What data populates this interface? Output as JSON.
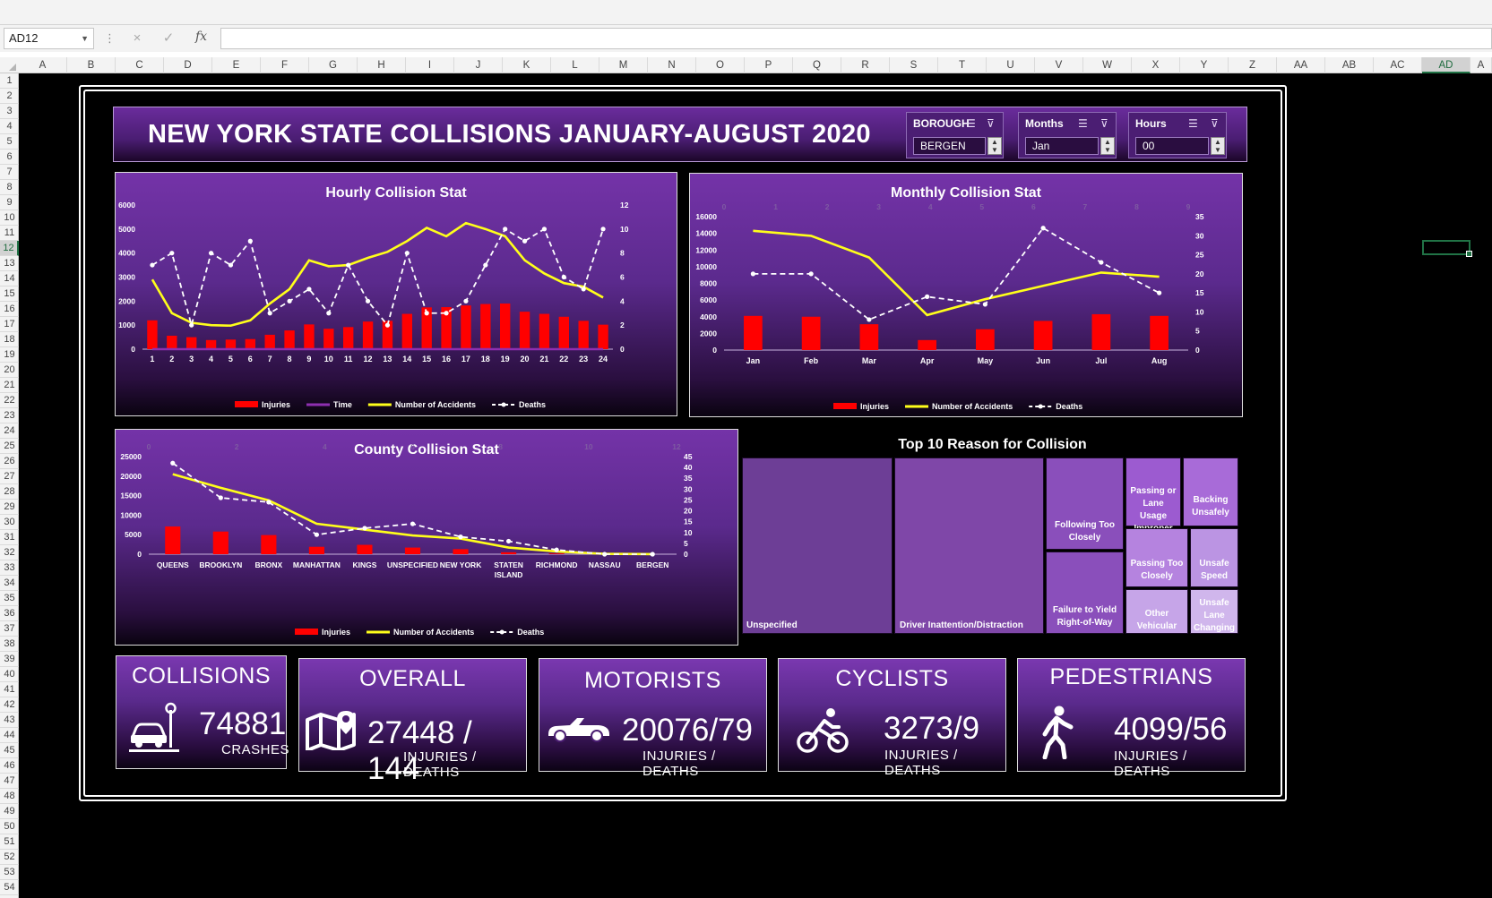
{
  "excel": {
    "name_box": "AD12",
    "columns": [
      "A",
      "B",
      "C",
      "D",
      "E",
      "F",
      "G",
      "H",
      "I",
      "J",
      "K",
      "L",
      "M",
      "N",
      "O",
      "P",
      "Q",
      "R",
      "S",
      "T",
      "U",
      "V",
      "W",
      "X",
      "Y",
      "Z",
      "AA",
      "AB",
      "AC",
      "AD",
      "A"
    ],
    "selected_column": "AD",
    "rows": [
      "1",
      "2",
      "3",
      "4",
      "5",
      "6",
      "7",
      "8",
      "9",
      "10",
      "11",
      "12",
      "13",
      "14",
      "15",
      "16",
      "17",
      "18",
      "19",
      "20",
      "21",
      "22",
      "23",
      "24",
      "25",
      "26",
      "27",
      "28",
      "29",
      "30",
      "31",
      "32",
      "33",
      "34",
      "35",
      "36",
      "37",
      "38",
      "39",
      "40",
      "41",
      "42",
      "43",
      "44",
      "45",
      "46",
      "47",
      "48",
      "49",
      "50",
      "51",
      "52",
      "53",
      "54"
    ],
    "selected_row": "12",
    "icons": {
      "cancel": "×",
      "enter": "✓",
      "fx": "fx"
    }
  },
  "dashboard": {
    "title": "NEW YORK STATE COLLISIONS JANUARY-AUGUST 2020",
    "slicers": [
      {
        "label": "BOROUGH",
        "value": "BERGEN"
      },
      {
        "label": "Months",
        "value": "Jan"
      },
      {
        "label": "Hours",
        "value": "00"
      }
    ]
  },
  "charts": {
    "hourly": {
      "title": "Hourly Collision Stat",
      "legend": [
        "Injuries",
        "Time",
        "Number of Accidents",
        "Deaths"
      ]
    },
    "monthly": {
      "title": "Monthly Collision Stat",
      "legend": [
        "Injuries",
        "Number of Accidents",
        "Deaths"
      ]
    },
    "county": {
      "title": "County Collision Stat",
      "legend": [
        "Injuries",
        "Number of Accidents",
        "Deaths"
      ]
    }
  },
  "treemap": {
    "title": "Top 10 Reason for Collision",
    "items": [
      "Unspecified",
      "Driver Inattention/Distraction",
      "Following Too Closely",
      "Failure to Yield Right-of-Way",
      "Passing or Lane Usage Improper",
      "Backing Unsafely",
      "Passing Too Closely",
      "Unsafe Speed",
      "Other Vehicular",
      "Unsafe Lane Changing"
    ]
  },
  "kpis": {
    "collisions": {
      "title": "COLLISIONS",
      "value": "74881",
      "sub": "CRASHES"
    },
    "overall": {
      "title": "OVERALL",
      "value": "27448 / 144",
      "sub": "INJURIES / DEATHS"
    },
    "motorists": {
      "title": "MOTORISTS",
      "value": "20076/79",
      "sub": "INJURIES / DEATHS"
    },
    "cyclists": {
      "title": "CYCLISTS",
      "value": "3273/9",
      "sub": "INJURIES / DEATHS"
    },
    "pedestrians": {
      "title": "PEDESTRIANS",
      "value": "4099/56",
      "sub": "INJURIES / DEATHS"
    }
  },
  "colors": {
    "bar": "#ff0000",
    "line": "#ffff1a",
    "deaths": "#ffffff",
    "time": "#8e2fb0"
  },
  "chart_data": [
    {
      "type": "bar",
      "title": "Hourly Collision Stat",
      "categories": [
        "1",
        "2",
        "3",
        "4",
        "5",
        "6",
        "7",
        "8",
        "9",
        "10",
        "11",
        "12",
        "13",
        "14",
        "15",
        "16",
        "17",
        "18",
        "19",
        "20",
        "21",
        "22",
        "23",
        "24"
      ],
      "ylim": [
        0,
        6000
      ],
      "y2lim": [
        0,
        12
      ],
      "y_ticks": [
        "0",
        "1000",
        "2000",
        "3000",
        "4000",
        "5000",
        "6000"
      ],
      "y2_ticks": [
        "0",
        "2",
        "4",
        "6",
        "8",
        "10",
        "12"
      ],
      "series": [
        {
          "name": "Injuries",
          "kind": "bar",
          "axis": "left",
          "values": [
            1200,
            560,
            500,
            380,
            400,
            420,
            600,
            780,
            1030,
            850,
            920,
            1150,
            1180,
            1470,
            1740,
            1750,
            1820,
            1880,
            1900,
            1560,
            1470,
            1350,
            1180,
            1020
          ]
        },
        {
          "name": "Time",
          "kind": "line",
          "axis": "left",
          "values": [
            0,
            0,
            0,
            0,
            0,
            0,
            0,
            0,
            0,
            0,
            0,
            0,
            0,
            0,
            0,
            0,
            0,
            0,
            0,
            0,
            0,
            0,
            0,
            0
          ]
        },
        {
          "name": "Number of Accidents",
          "kind": "line",
          "axis": "left",
          "values": [
            2900,
            1500,
            1100,
            1000,
            980,
            1200,
            1900,
            2500,
            3700,
            3450,
            3500,
            3800,
            4050,
            4500,
            5050,
            4700,
            5250,
            5000,
            4700,
            3700,
            3150,
            2750,
            2600,
            2150
          ]
        },
        {
          "name": "Deaths",
          "kind": "dashed-line",
          "axis": "right",
          "values": [
            7,
            8,
            2,
            8,
            7,
            9,
            3,
            4,
            5,
            3,
            7,
            4,
            2,
            8,
            3,
            3,
            4,
            7,
            10,
            9,
            10,
            6,
            5,
            10
          ]
        }
      ]
    },
    {
      "type": "bar",
      "title": "Monthly Collision Stat",
      "categories": [
        "Jan",
        "Feb",
        "Mar",
        "Apr",
        "May",
        "Jun",
        "Jul",
        "Aug"
      ],
      "ylim": [
        0,
        16000
      ],
      "y2lim": [
        0,
        35
      ],
      "y_ticks": [
        "0",
        "2000",
        "4000",
        "6000",
        "8000",
        "10000",
        "12000",
        "14000",
        "16000"
      ],
      "y2_ticks": [
        "0",
        "5",
        "10",
        "15",
        "20",
        "25",
        "30",
        "35"
      ],
      "top_ticks": [
        "0",
        "1",
        "2",
        "3",
        "4",
        "5",
        "6",
        "7",
        "8",
        "9"
      ],
      "series": [
        {
          "name": "Injuries",
          "kind": "bar",
          "axis": "left",
          "values": [
            4100,
            4000,
            3100,
            1200,
            2500,
            3500,
            4300,
            4100
          ]
        },
        {
          "name": "Number of Accidents",
          "kind": "line",
          "axis": "left",
          "values": [
            14300,
            13700,
            11100,
            4200,
            6100,
            7700,
            9300,
            8800
          ]
        },
        {
          "name": "Deaths",
          "kind": "dashed-line",
          "axis": "right",
          "values": [
            20,
            20,
            8,
            14,
            12,
            32,
            23,
            15
          ]
        }
      ]
    },
    {
      "type": "bar",
      "title": "County Collision Stat",
      "categories": [
        "QUEENS",
        "BROOKLYN",
        "BRONX",
        "MANHATTAN",
        "KINGS",
        "UNSPECIFIED",
        "NEW YORK",
        "STATEN ISLAND",
        "RICHMOND",
        "NASSAU",
        "BERGEN"
      ],
      "ylim": [
        0,
        25000
      ],
      "y2lim": [
        0,
        45
      ],
      "y_ticks": [
        "0",
        "5000",
        "10000",
        "15000",
        "20000",
        "25000"
      ],
      "y2_ticks": [
        "0",
        "5",
        "10",
        "15",
        "20",
        "25",
        "30",
        "35",
        "40",
        "45"
      ],
      "top_ticks": [
        "0",
        "2",
        "4",
        "6",
        "8",
        "10",
        "12"
      ],
      "series": [
        {
          "name": "Injuries",
          "kind": "bar",
          "axis": "left",
          "values": [
            7100,
            5800,
            4900,
            1900,
            2400,
            1700,
            1300,
            500,
            200,
            50,
            10
          ]
        },
        {
          "name": "Number of Accidents",
          "kind": "line",
          "axis": "left",
          "values": [
            20500,
            17000,
            13800,
            7800,
            6300,
            4800,
            4000,
            1700,
            700,
            100,
            10
          ]
        },
        {
          "name": "Deaths",
          "kind": "dashed-line",
          "axis": "right",
          "values": [
            42,
            26,
            24,
            9,
            12,
            14,
            8,
            6,
            2,
            0,
            0
          ]
        }
      ]
    }
  ]
}
